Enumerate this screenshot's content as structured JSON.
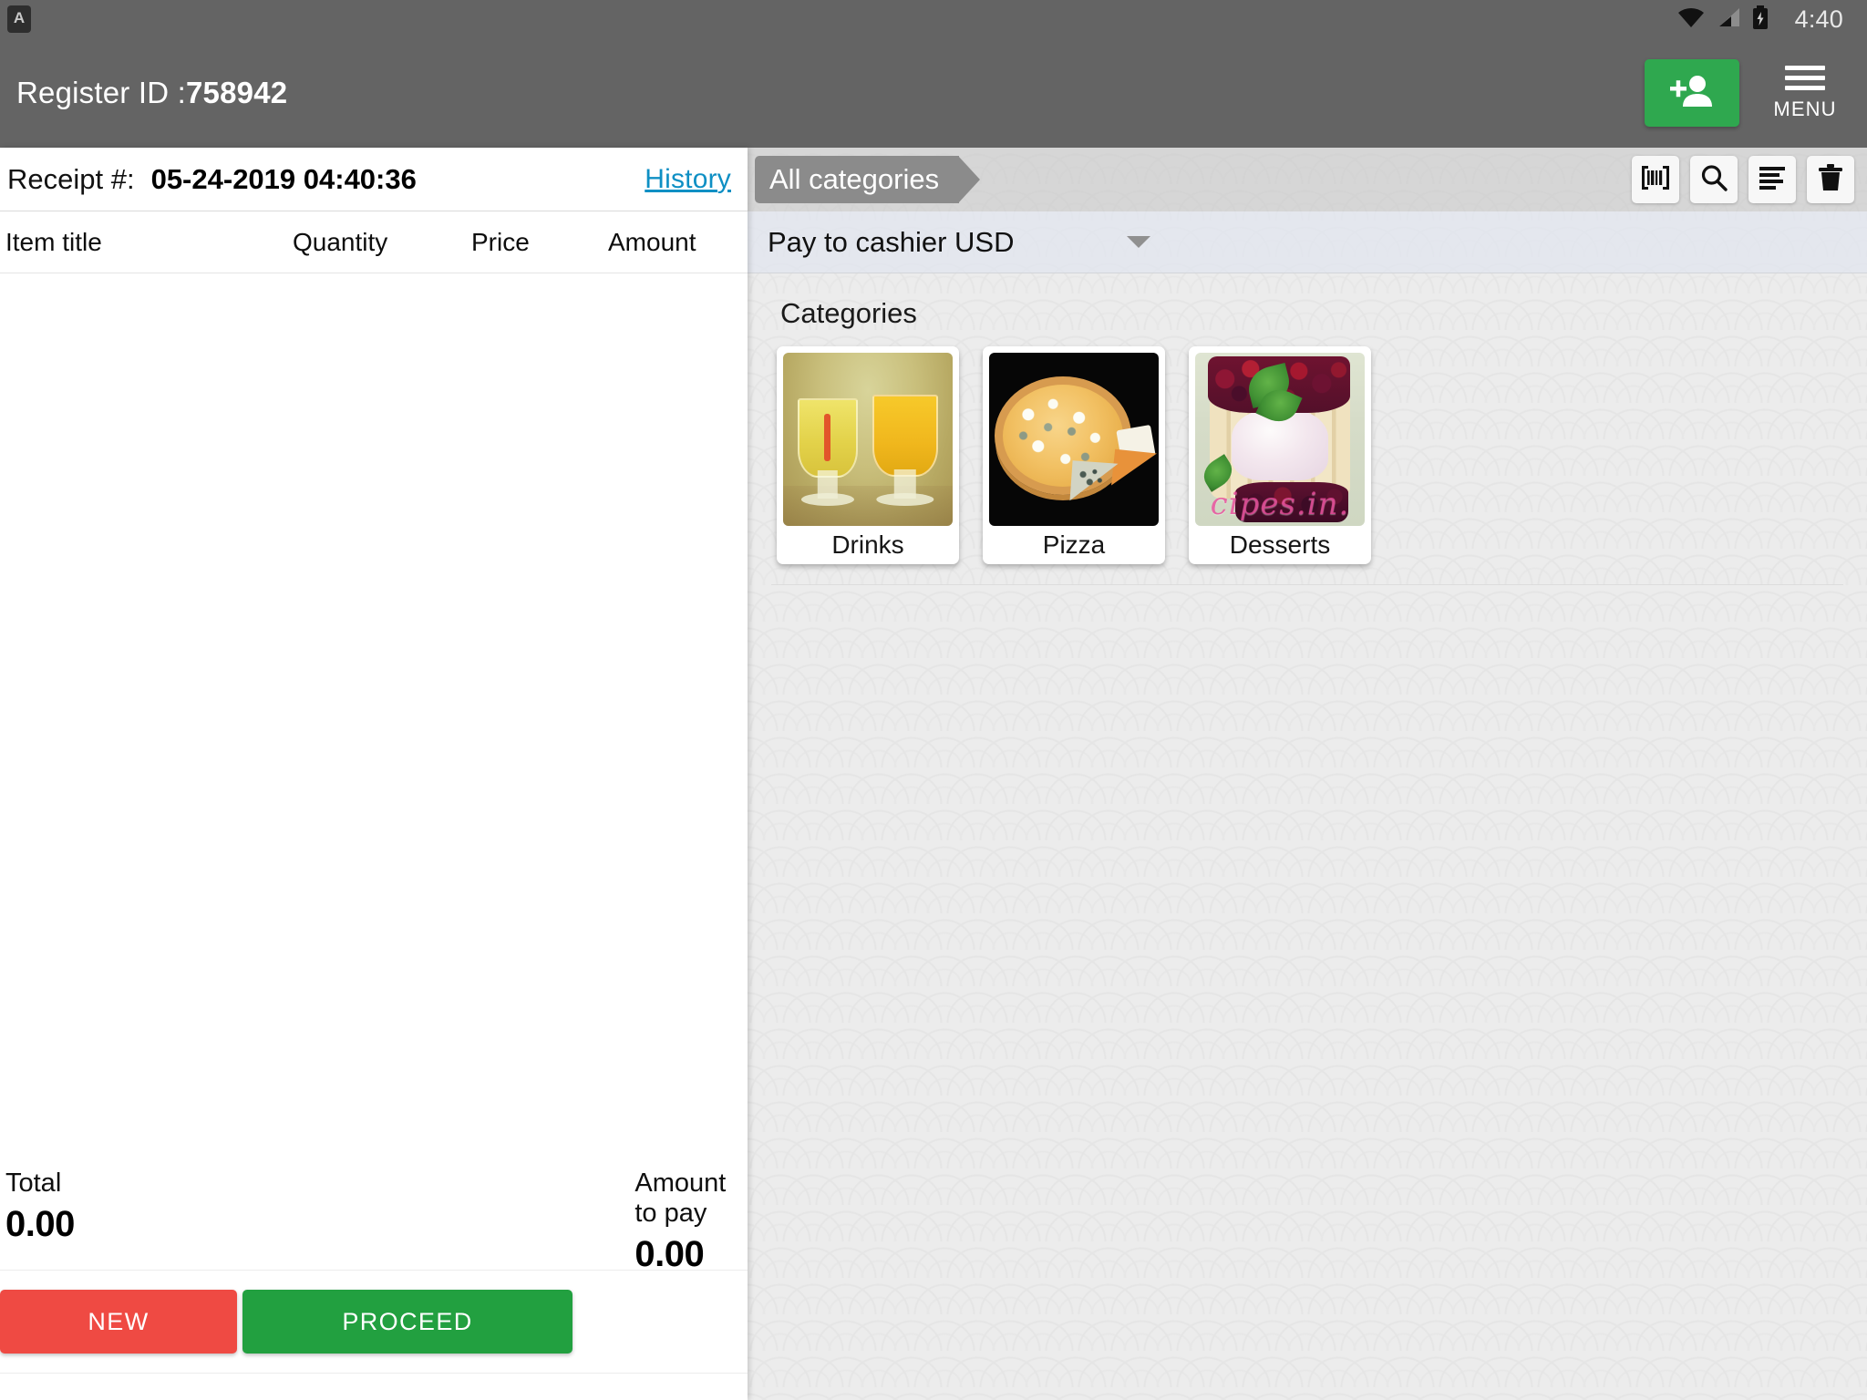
{
  "statusbar": {
    "app_icon": "app-letter-a-icon",
    "wifi_icon": "wifi-icon",
    "signal_icon": "cellular-signal-icon",
    "battery_icon": "battery-charging-icon",
    "clock": "4:40"
  },
  "appbar": {
    "register_label": "Register ID :",
    "register_id": "758942",
    "add_customer_icon": "add-person-icon",
    "menu_label": "MENU",
    "menu_icon": "hamburger-menu-icon",
    "background": "#646464",
    "accent_green": "#2fa84f"
  },
  "receipt": {
    "receipt_caption": "Receipt #:",
    "receipt_number": "05-24-2019 04:40:36",
    "history_link": "History",
    "columns": [
      "Item title",
      "Quantity",
      "Price",
      "Amount"
    ],
    "items": [],
    "total_caption": "Total",
    "total_value": "0.00",
    "amount_to_pay_caption": "Amount to pay",
    "amount_to_pay_value": "0.00",
    "new_button": "NEW",
    "proceed_button": "PROCEED",
    "new_color": "#ef4a43",
    "proceed_color": "#22a040",
    "history_color": "#0e8fc4"
  },
  "catalog": {
    "breadcrumb": "All categories",
    "tools": [
      {
        "name": "barcode-scanner-icon",
        "label": "Scan barcode"
      },
      {
        "name": "search-icon",
        "label": "Search"
      },
      {
        "name": "sort-list-icon",
        "label": "Sort"
      },
      {
        "name": "trash-icon",
        "label": "Delete"
      }
    ],
    "payment_mode": "Pay to cashier USD",
    "payment_caret_icon": "chevron-down-icon",
    "section_title": "Categories",
    "categories": [
      {
        "label": "Drinks",
        "image": "two-glasses-of-juice-photo"
      },
      {
        "label": "Pizza",
        "image": "four-cheese-pizza-photo"
      },
      {
        "label": "Desserts",
        "image": "berry-charlotte-cake-photo"
      }
    ],
    "dessert_watermark": "cipes.in."
  }
}
